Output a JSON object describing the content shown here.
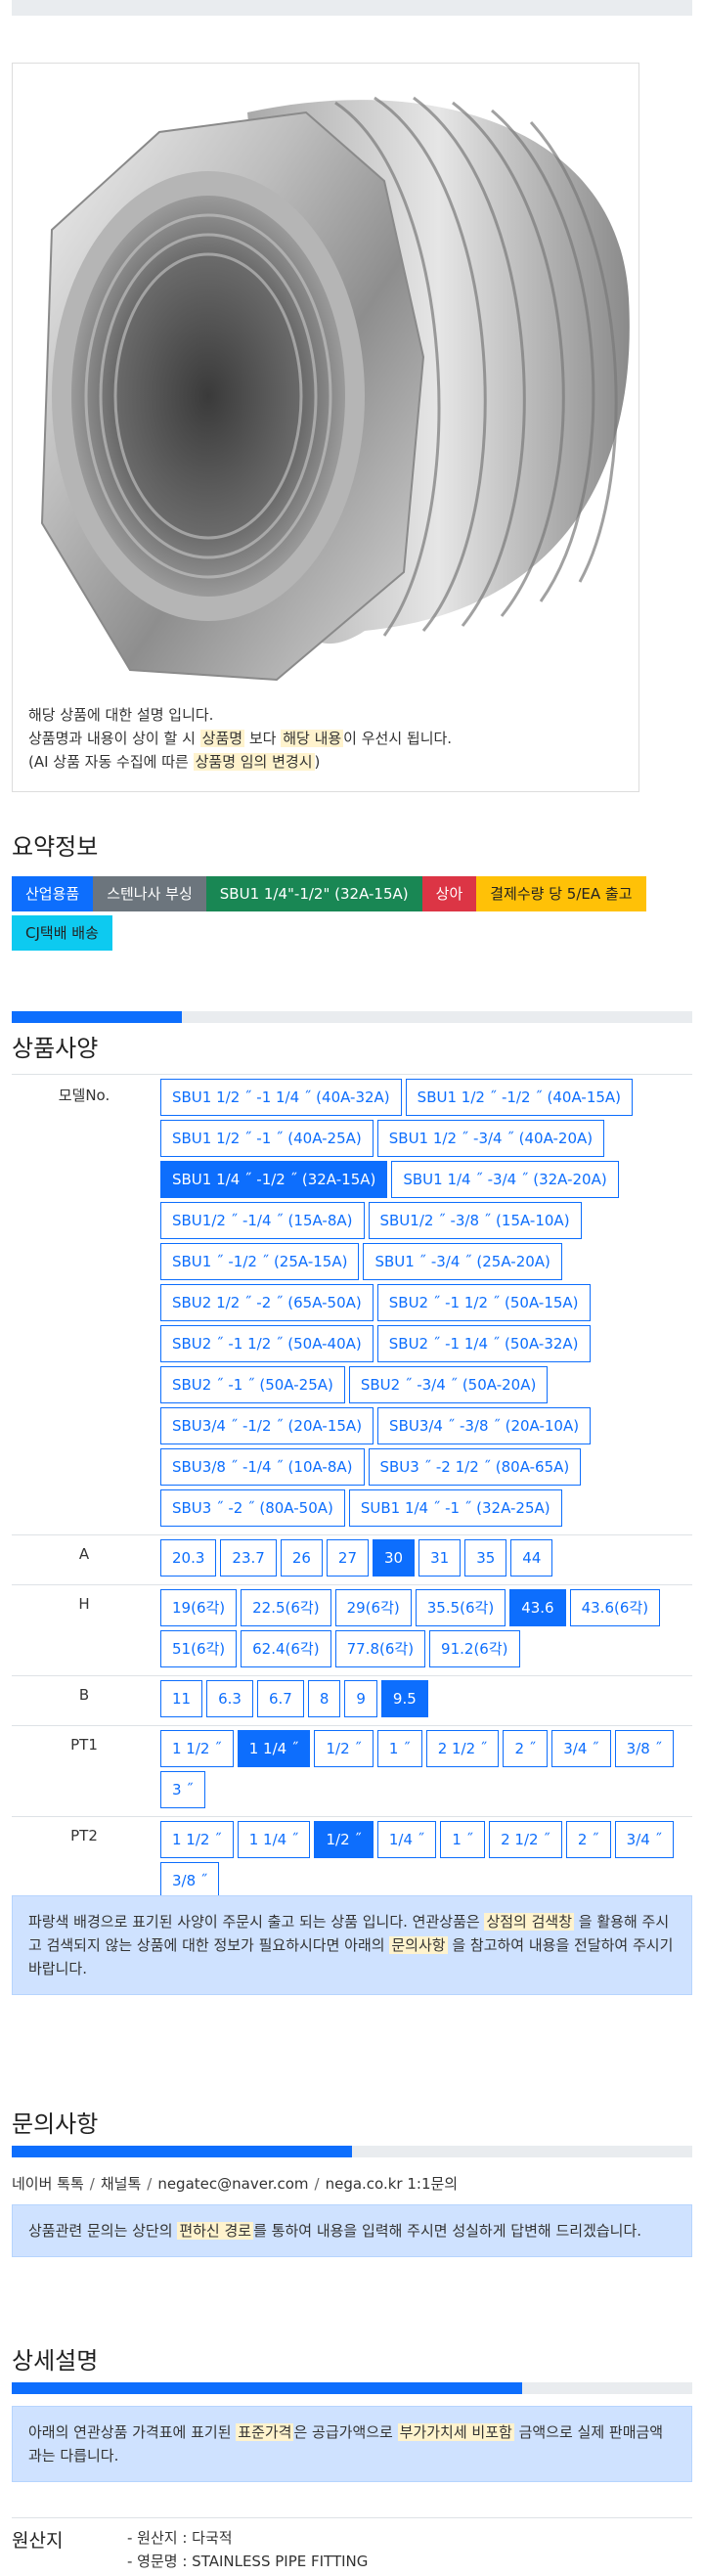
{
  "product_note": {
    "line1": "해당 상품에 대한 설명 입니다.",
    "line2_a": "상품명과 내용이 상이 할 시 ",
    "line2_hl1": "상품명",
    "line2_b": " 보다 ",
    "line2_hl2": "해당 내용",
    "line2_c": "이 우선시 됩니다.",
    "line3_a": "(AI 상품 자동 수집에 따른 ",
    "line3_hl": "상품명 임의 변경시",
    "line3_b": ")"
  },
  "summary": {
    "title": "요약정보",
    "badges": [
      {
        "label": "산업용품",
        "color": "#0d6efd"
      },
      {
        "label": "스텐나사 부싱",
        "color": "#6c757d"
      },
      {
        "label": "SBU1 1/4\"-1/2\" (32A-15A)",
        "color": "#198754"
      },
      {
        "label": "상아",
        "color": "#dc3545"
      },
      {
        "label": "결제수량 당 5/EA 출고",
        "color": "#ffc107",
        "text": "#222"
      },
      {
        "label": "CJ택배 배송",
        "color": "#0dcaf0",
        "text": "#222"
      }
    ]
  },
  "spec": {
    "title": "상품사양",
    "progress": 0.25,
    "rows": [
      {
        "label": "모델No.",
        "options": [
          "SBU1 1/2 ˝ -1 1/4 ˝ (40A-32A)",
          "SBU1 1/2 ˝ -1/2 ˝ (40A-15A)",
          "SBU1 1/2 ˝ -1 ˝ (40A-25A)",
          "SBU1 1/2 ˝ -3/4 ˝ (40A-20A)",
          "SBU1 1/4 ˝ -1/2 ˝ (32A-15A)",
          "SBU1 1/4 ˝ -3/4 ˝ (32A-20A)",
          "SBU1/2 ˝ -1/4 ˝ (15A-8A)",
          "SBU1/2 ˝ -3/8 ˝ (15A-10A)",
          "SBU1 ˝ -1/2 ˝ (25A-15A)",
          "SBU1 ˝ -3/4 ˝ (25A-20A)",
          "SBU2 1/2 ˝ -2 ˝ (65A-50A)",
          "SBU2 ˝ -1 1/2 ˝ (50A-15A)",
          "SBU2 ˝ -1 1/2 ˝ (50A-40A)",
          "SBU2 ˝ -1 1/4 ˝ (50A-32A)",
          "SBU2 ˝ -1 ˝ (50A-25A)",
          "SBU2 ˝ -3/4 ˝ (50A-20A)",
          "SBU3/4 ˝ -1/2 ˝ (20A-15A)",
          "SBU3/4 ˝ -3/8 ˝ (20A-10A)",
          "SBU3/8 ˝ -1/4 ˝ (10A-8A)",
          "SBU3 ˝ -2 1/2 ˝ (80A-65A)",
          "SBU3 ˝ -2 ˝ (80A-50A)",
          "SUB1 1/4 ˝ -1 ˝ (32A-25A)"
        ],
        "selected": 4
      },
      {
        "label": "A",
        "options": [
          "20.3",
          "23.7",
          "26",
          "27",
          "30",
          "31",
          "35",
          "44"
        ],
        "selected": 4
      },
      {
        "label": "H",
        "options": [
          "19(6각)",
          "22.5(6각)",
          "29(6각)",
          "35.5(6각)",
          "43.6",
          "43.6(6각)",
          "51(6각)",
          "62.4(6각)",
          "77.8(6각)",
          "91.2(6각)"
        ],
        "selected": 4
      },
      {
        "label": "B",
        "options": [
          "11",
          "6.3",
          "6.7",
          "8",
          "9",
          "9.5"
        ],
        "selected": 5
      },
      {
        "label": "PT1",
        "options": [
          "1 1/2 ˝",
          "1 1/4 ˝",
          "1/2 ˝",
          "1 ˝",
          "2 1/2 ˝",
          "2 ˝",
          "3/4 ˝",
          "3/8 ˝",
          "3 ˝"
        ],
        "selected": 1
      },
      {
        "label": "PT2",
        "options": [
          "1 1/2 ˝",
          "1 1/4 ˝",
          "1/2 ˝",
          "1/4 ˝",
          "1 ˝",
          "2 1/2 ˝",
          "2 ˝",
          "3/4 ˝",
          "3/8 ˝"
        ],
        "selected": 2
      }
    ],
    "info_a": "파랑색 배경으로 표기된 사양이 주문시 출고 되는 상품 입니다. 연관상품은 ",
    "info_hl1": "상점의 검색창",
    "info_b": " 을 활용해 주시고 검색되지 않는 상품에 대한 정보가 필요하시다면 아래의 ",
    "info_hl2": "문의사항",
    "info_c": " 을 참고하여 내용을 전달하여 주시기 바랍니다."
  },
  "inquiry": {
    "title": "문의사항",
    "progress": 0.5,
    "contacts": [
      "네이버 톡톡",
      "채널톡",
      "negatec@naver.com",
      "nega.co.kr 1:1문의"
    ],
    "sep": "/",
    "info_a": "상품관련 문의는 상단의 ",
    "info_hl": "편하신 경로",
    "info_b": "를 통하여 내용을 입력해 주시면 성실하게 답변해 드리겠습니다."
  },
  "detail": {
    "title": "상세설명",
    "progress": 0.75,
    "info_a": "아래의 연관상품 가격표에 표기된 ",
    "info_hl1": "표준가격",
    "info_b": "은 공급가액으로 ",
    "info_hl2": "부가가치세 비포함",
    "info_c": " 금액으로 실제 판매금액과는 다릅니다."
  },
  "origin": {
    "label": "원산지",
    "line1": "- 원산지 : 다국적",
    "line2": "- 영문명 : STAINLESS PIPE FITTING"
  }
}
